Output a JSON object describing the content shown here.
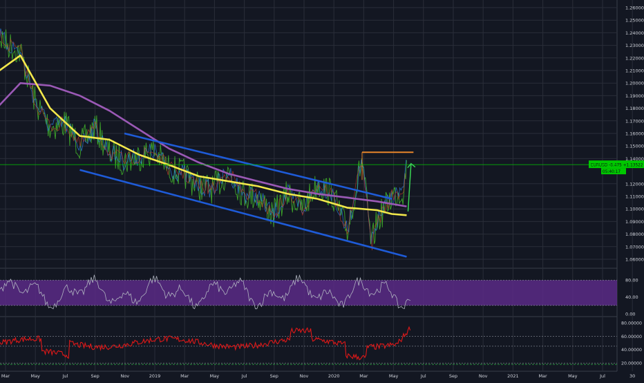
{
  "colors": {
    "background": "#131722",
    "grid": "#2a2e39",
    "axis_text": "#d1d4dc",
    "price_line_color": "#00c800",
    "channel_color": "#1e5bd8",
    "resistance_color": "#e8862a",
    "arrow_color": "#39d353",
    "ema_fast_color": "#f2e84b",
    "ema_slow_color": "#9b59b6",
    "rsi_band_color": "#5b2a86",
    "osc_color": "#e01818"
  },
  "price_axis": {
    "labels": [
      "1.26000",
      "1.25000",
      "1.24000",
      "1.23000",
      "1.22000",
      "1.21000",
      "1.20000",
      "1.19000",
      "1.18000",
      "1.17000",
      "1.16000",
      "1.15000",
      "1.14000",
      "1.12000",
      "1.11000",
      "1.10000",
      "1.09000",
      "1.08000",
      "1.07000",
      "1.06000"
    ]
  },
  "time_axis": {
    "labels": [
      "Mar",
      "May",
      "Jul",
      "Sep",
      "Nov",
      "2019",
      "Mar",
      "May",
      "Jul",
      "Sep",
      "Nov",
      "2020",
      "Mar",
      "May",
      "Jul",
      "Sep",
      "Nov",
      "2021",
      "Mar",
      "May",
      "Jul",
      "30"
    ]
  },
  "rsi_axis": {
    "labels": [
      "80.00",
      "40.00",
      "0.00"
    ]
  },
  "osc_axis": {
    "labels": [
      "80.00000",
      "60.00000",
      "40.00000",
      "20.00000"
    ]
  },
  "price_badge": {
    "symbol_text": "EURUSD -8.475 +1.13522",
    "countdown_text": "05:40:17"
  },
  "chart_data": {
    "type": "line",
    "title": "",
    "x_range": [
      "2018-03",
      "2021-07"
    ],
    "y_range": [
      1.055,
      1.265
    ],
    "current_price": 1.13522,
    "series": [
      {
        "values": [
          [
            "2018-02",
            1.245
          ],
          [
            "2018-03",
            1.232
          ],
          [
            "2018-04",
            1.225
          ],
          [
            "2018-05",
            1.185
          ],
          [
            "2018-06",
            1.165
          ],
          [
            "2018-07",
            1.168
          ],
          [
            "2018-08",
            1.15
          ],
          [
            "2018-09",
            1.165
          ],
          [
            "2018-10",
            1.145
          ],
          [
            "2018-11",
            1.138
          ],
          [
            "2018-12",
            1.142
          ],
          [
            "2019-01",
            1.146
          ],
          [
            "2019-02",
            1.132
          ],
          [
            "2019-03",
            1.128
          ],
          [
            "2019-04",
            1.118
          ],
          [
            "2019-05",
            1.116
          ],
          [
            "2019-06",
            1.13
          ],
          [
            "2019-07",
            1.112
          ],
          [
            "2019-08",
            1.11
          ],
          [
            "2019-09",
            1.095
          ],
          [
            "2019-10",
            1.112
          ],
          [
            "2019-11",
            1.1
          ],
          [
            "2019-12",
            1.12
          ],
          [
            "2020-01",
            1.112
          ],
          [
            "2020-02",
            1.082
          ],
          [
            "2020-03",
            1.14
          ],
          [
            "2020-03-20",
            1.07
          ],
          [
            "2020-04",
            1.09
          ],
          [
            "2020-05",
            1.11
          ],
          [
            "2020-05-25",
            1.115
          ],
          [
            "2020-06",
            1.135
          ]
        ]
      },
      {
        "values": [
          [
            "2018-02",
            1.205
          ],
          [
            "2018-04",
            1.222
          ],
          [
            "2018-06",
            1.18
          ],
          [
            "2018-08",
            1.158
          ],
          [
            "2018-10",
            1.155
          ],
          [
            "2018-12",
            1.143
          ],
          [
            "2019-02",
            1.135
          ],
          [
            "2019-04",
            1.126
          ],
          [
            "2019-06",
            1.122
          ],
          [
            "2019-08",
            1.118
          ],
          [
            "2019-10",
            1.112
          ],
          [
            "2019-12",
            1.108
          ],
          [
            "2020-02",
            1.101
          ],
          [
            "2020-04",
            1.099
          ],
          [
            "2020-05",
            1.096
          ],
          [
            "2020-06",
            1.095
          ]
        ]
      },
      {
        "values": [
          [
            "2018-02",
            1.175
          ],
          [
            "2018-04",
            1.2
          ],
          [
            "2018-06",
            1.198
          ],
          [
            "2018-08",
            1.19
          ],
          [
            "2018-10",
            1.178
          ],
          [
            "2018-12",
            1.163
          ],
          [
            "2019-02",
            1.148
          ],
          [
            "2019-04",
            1.137
          ],
          [
            "2019-06",
            1.128
          ],
          [
            "2019-08",
            1.122
          ],
          [
            "2019-10",
            1.116
          ],
          [
            "2019-12",
            1.112
          ],
          [
            "2020-02",
            1.109
          ],
          [
            "2020-04",
            1.106
          ],
          [
            "2020-06",
            1.102
          ]
        ]
      }
    ],
    "channel_upper": [
      [
        "2018-11",
        1.16
      ],
      [
        "2020-05",
        1.108
      ]
    ],
    "channel_lower": [
      [
        "2018-08",
        1.131
      ],
      [
        "2020-06",
        1.062
      ]
    ],
    "resistance_level": {
      "price": 1.145,
      "from": "2020-03",
      "to": "2020-06-15"
    },
    "rsi": {
      "range": [
        0,
        100
      ],
      "band": [
        20,
        80
      ]
    },
    "oscillator": {
      "range": [
        15,
        85
      ]
    }
  }
}
